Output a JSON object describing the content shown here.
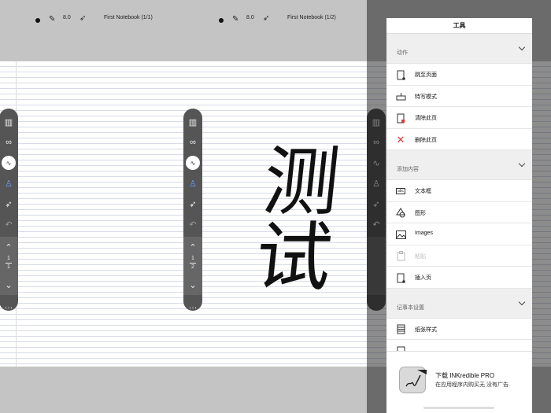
{
  "left_page": {
    "pen_size": "8.0",
    "notebook_title": "First Notebook (1/1)",
    "pager": {
      "current": "1",
      "total": "1"
    },
    "more": "…"
  },
  "middle_page": {
    "pen_size": "8.0",
    "notebook_title": "First Notebook (1/2)",
    "pager": {
      "current": "1",
      "total": "2"
    },
    "more": "…",
    "handwriting_text": "测试"
  },
  "panel": {
    "title": "工具",
    "sections": [
      {
        "label": "动作",
        "items": [
          {
            "label": "跳至页面",
            "icon": "goto-page-icon"
          },
          {
            "label": "特写模式",
            "icon": "closeup-mode-icon"
          },
          {
            "label": "清除此页",
            "icon": "clear-page-icon"
          },
          {
            "label": "删除此页",
            "icon": "delete-page-icon"
          }
        ]
      },
      {
        "label": "添加内容",
        "items": [
          {
            "label": "文本框",
            "icon": "text-box-icon"
          },
          {
            "label": "图形",
            "icon": "shapes-icon"
          },
          {
            "label": "Images",
            "icon": "image-icon"
          },
          {
            "label": "粘贴",
            "icon": "paste-icon",
            "disabled": true
          },
          {
            "label": "插入页",
            "icon": "insert-page-icon"
          }
        ]
      },
      {
        "label": "记事本设置",
        "items": [
          {
            "label": "纸张样式",
            "icon": "paper-style-icon"
          }
        ]
      }
    ]
  },
  "ad": {
    "title": "下载 INKredible PRO",
    "subtitle": "在应用程序内购买无 没有广告."
  },
  "colors": {
    "accent_blue": "#2a5fd6",
    "delete_red": "#d63a3a"
  }
}
